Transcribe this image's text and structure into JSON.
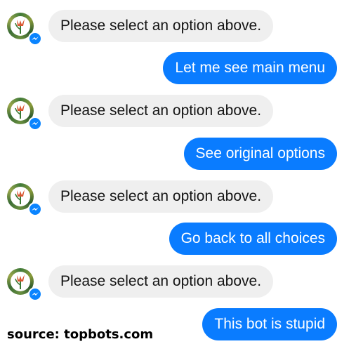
{
  "colors": {
    "incoming_bubble": "#efefef",
    "outgoing_bubble": "#0a7cff",
    "messenger_badge": "#0a84ff"
  },
  "messages": [
    {
      "sender": "bot",
      "text": "Please select an option above."
    },
    {
      "sender": "user",
      "text": "Let me see main menu"
    },
    {
      "sender": "bot",
      "text": "Please select an option above."
    },
    {
      "sender": "user",
      "text": "See original options"
    },
    {
      "sender": "bot",
      "text": "Please select an option above."
    },
    {
      "sender": "user",
      "text": "Go back to all choices"
    },
    {
      "sender": "bot",
      "text": "Please select an option above."
    },
    {
      "sender": "user",
      "text": "This bot is stupid"
    }
  ],
  "icons": {
    "avatar": "bot-avatar-tulip-icon",
    "badge": "messenger-icon"
  },
  "footer": {
    "source": "source: topbots.com"
  }
}
